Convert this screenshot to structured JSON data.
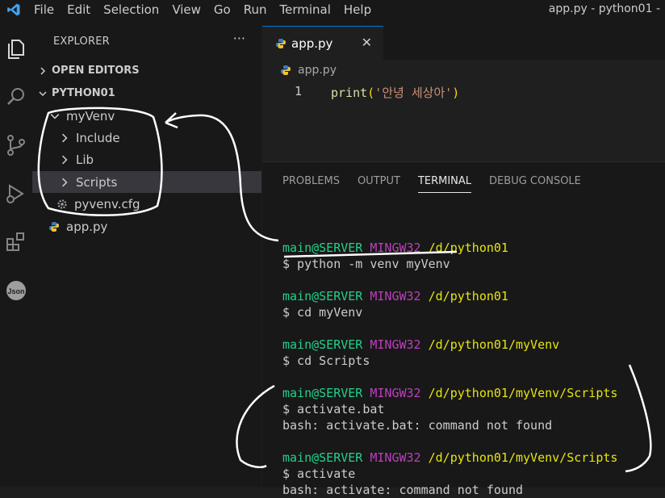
{
  "menubar": {
    "items": [
      "File",
      "Edit",
      "Selection",
      "View",
      "Go",
      "Run",
      "Terminal",
      "Help"
    ],
    "window_title": "app.py - python01 - "
  },
  "activity_bar": [
    "files-icon",
    "search-icon",
    "source-control-icon",
    "run-debug-icon",
    "extensions-icon",
    "json-icon"
  ],
  "sidebar": {
    "header": "EXPLORER",
    "more": "···",
    "open_editors": "OPEN EDITORS",
    "workspace": "PYTHON01",
    "tree": [
      {
        "label": "myVenv",
        "type": "folder-open"
      },
      {
        "label": "Include",
        "type": "folder"
      },
      {
        "label": "Lib",
        "type": "folder"
      },
      {
        "label": "Scripts",
        "type": "folder"
      },
      {
        "label": "pyvenv.cfg",
        "type": "gear-file"
      },
      {
        "label": "app.py",
        "type": "python-file"
      }
    ]
  },
  "editor": {
    "tab_label": "app.py",
    "tab_close": "✕",
    "breadcrumb": "app.py",
    "lines": [
      {
        "num": "1",
        "func": "print",
        "open": "(",
        "str": "'안녕 세상아'",
        "close": ")"
      }
    ]
  },
  "panel": {
    "tabs": [
      "PROBLEMS",
      "OUTPUT",
      "TERMINAL",
      "DEBUG CONSOLE"
    ],
    "active_tab": "TERMINAL",
    "terminal": [
      {
        "user": "main@SERVER",
        "sys": "MINGW32",
        "path": "/d/python01",
        "cmd": "$ python -m venv myVenv",
        "out": ""
      },
      {
        "user": "main@SERVER",
        "sys": "MINGW32",
        "path": "/d/python01",
        "cmd": "$ cd myVenv",
        "out": ""
      },
      {
        "user": "main@SERVER",
        "sys": "MINGW32",
        "path": "/d/python01/myVenv",
        "cmd": "$ cd Scripts",
        "out": ""
      },
      {
        "user": "main@SERVER",
        "sys": "MINGW32",
        "path": "/d/python01/myVenv/Scripts",
        "cmd": "$ activate.bat",
        "out": "bash: activate.bat: command not found"
      },
      {
        "user": "main@SERVER",
        "sys": "MINGW32",
        "path": "/d/python01/myVenv/Scripts",
        "cmd": "$ activate",
        "out": "bash: activate: command not found"
      }
    ]
  },
  "colors": {
    "accent": "#0078d4",
    "terminal_user": "#23d18b",
    "terminal_sys": "#bc3fbc",
    "terminal_path": "#e5e510",
    "string": "#ce9178",
    "function": "#dcdcaa"
  }
}
